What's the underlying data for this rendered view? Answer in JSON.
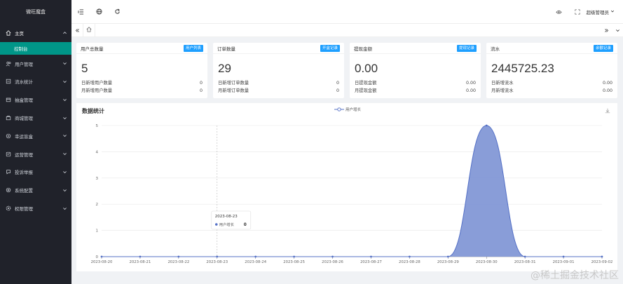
{
  "sidebar": {
    "brand": "微旺魔盒",
    "home": "主页",
    "active_sub": "控制台",
    "items": [
      {
        "label": "用户管理",
        "icon": "users-icon"
      },
      {
        "label": "流水统计",
        "icon": "flow-icon"
      },
      {
        "label": "抽盒管理",
        "icon": "box-icon"
      },
      {
        "label": "商城管理",
        "icon": "shop-icon"
      },
      {
        "label": "幸运盲盒",
        "icon": "lucky-icon"
      },
      {
        "label": "运营管理",
        "icon": "ops-icon"
      },
      {
        "label": "投诉举报",
        "icon": "complaint-icon"
      },
      {
        "label": "系统配置",
        "icon": "settings-icon"
      },
      {
        "label": "权限管理",
        "icon": "permission-icon"
      }
    ]
  },
  "topbar": {
    "admin_label": "超级管理员"
  },
  "cards": [
    {
      "title": "用户总数量",
      "badge": "用户列表",
      "value": "5",
      "rows": [
        {
          "k": "日新增用户数量",
          "v": "0"
        },
        {
          "k": "月新增用户数量",
          "v": "0"
        }
      ]
    },
    {
      "title": "订单数量",
      "badge": "开盒记录",
      "value": "29",
      "rows": [
        {
          "k": "日新增订单数量",
          "v": "0"
        },
        {
          "k": "月新增订单数量",
          "v": "0"
        }
      ]
    },
    {
      "title": "提现金额",
      "badge": "提现记录",
      "value": "0.00",
      "rows": [
        {
          "k": "日提现金额",
          "v": "0.00"
        },
        {
          "k": "月提现金额",
          "v": "0.00"
        }
      ]
    },
    {
      "title": "流水",
      "badge": "余额记录",
      "value": "2445725.23",
      "rows": [
        {
          "k": "日新增流水",
          "v": "0.00"
        },
        {
          "k": "月新增流水",
          "v": "0.00"
        }
      ]
    }
  ],
  "chart": {
    "title": "数据统计",
    "tooltip": {
      "date": "2023-08-23",
      "series": "用户增长",
      "value": "0"
    }
  },
  "chart_data": {
    "type": "area",
    "x": [
      "2023-08-20",
      "2023-08-21",
      "2023-08-22",
      "2023-08-23",
      "2023-08-24",
      "2023-08-25",
      "2023-08-26",
      "2023-08-27",
      "2023-08-28",
      "2023-08-29",
      "2023-08-30",
      "2023-08-31",
      "2023-09-01",
      "2023-09-02"
    ],
    "series": [
      {
        "name": "用户增长",
        "values": [
          0,
          0,
          0,
          0,
          0,
          0,
          0,
          0,
          0,
          0,
          5,
          0,
          0,
          0
        ]
      }
    ],
    "ylim": [
      0,
      5
    ],
    "yticks": [
      0,
      1,
      2,
      3,
      4,
      5
    ],
    "grid": true,
    "legend": "top-center",
    "colors": {
      "line": "#5470c6",
      "area": "#8398d6"
    }
  },
  "watermark": "@稀土掘金技术社区"
}
